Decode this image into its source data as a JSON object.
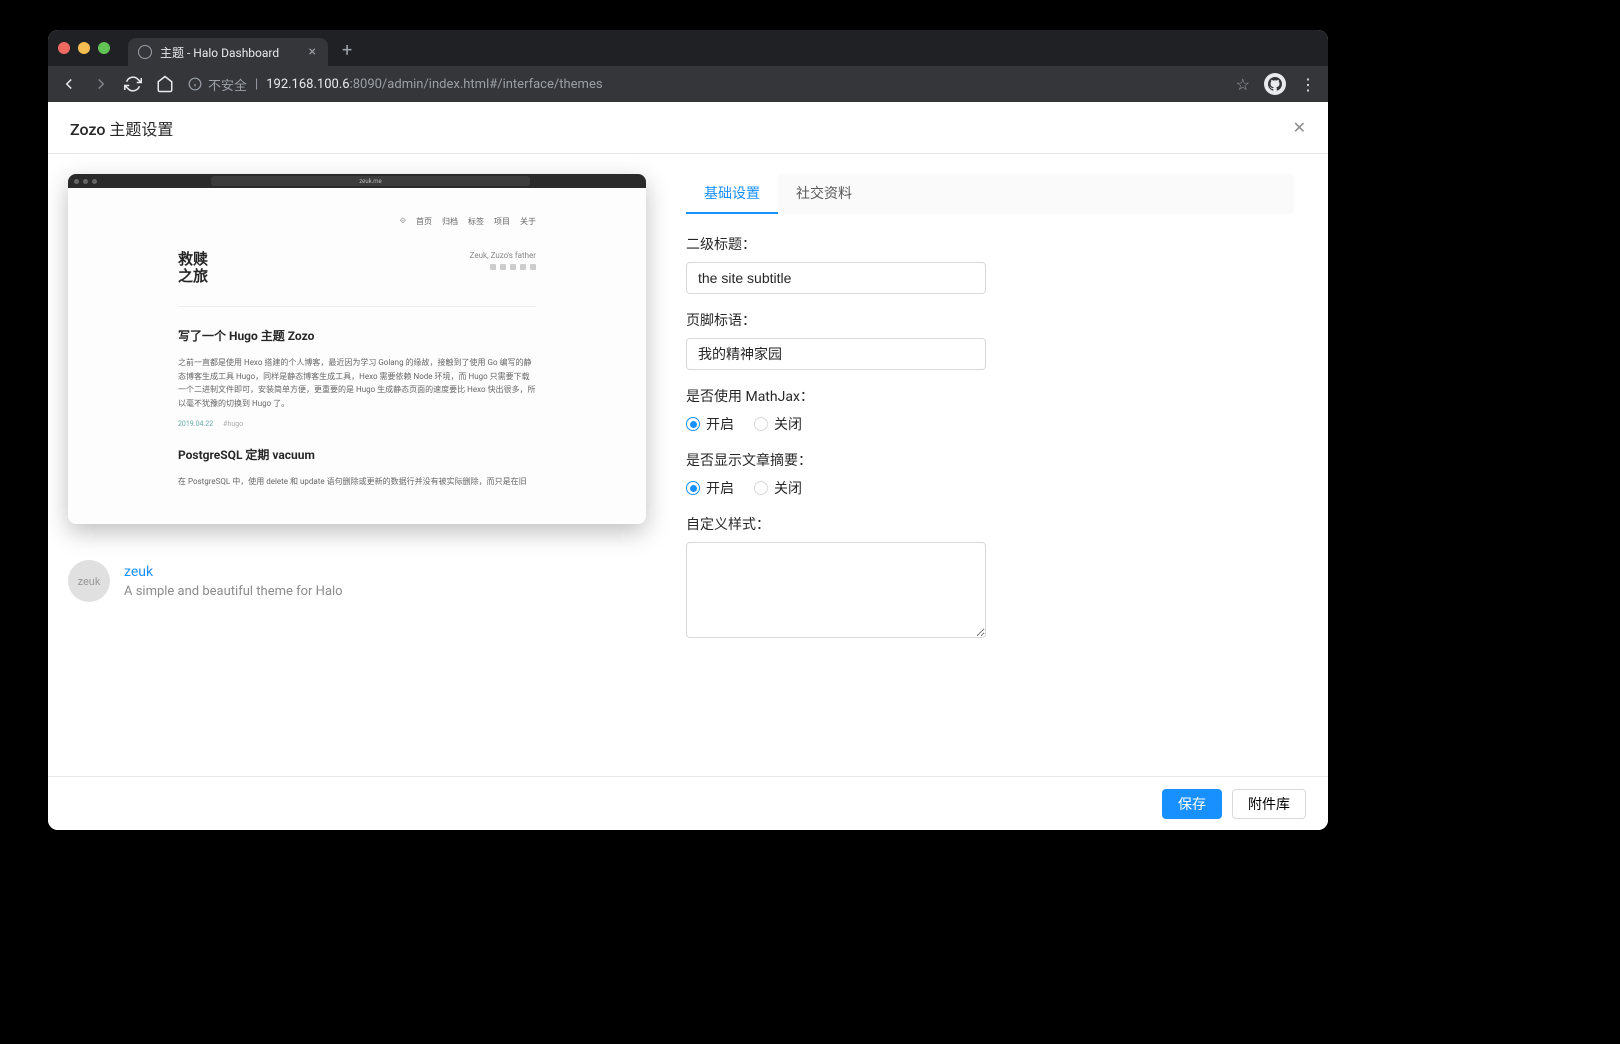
{
  "browser": {
    "tab_title": "主题 - Halo Dashboard",
    "url_security": "不安全",
    "url_host": "192.168.100.6",
    "url_path": ":8090/admin/index.html#/interface/themes"
  },
  "header": {
    "title": "Zozo 主题设置"
  },
  "preview": {
    "url": "zeuk.me",
    "nav": [
      "首页",
      "归档",
      "标签",
      "项目",
      "关于"
    ],
    "logo_line1": "救赎",
    "logo_line2": "之旅",
    "tagline": "Zeuk, Zuzo's father",
    "post1_title": "写了一个 Hugo 主题 Zozo",
    "post1_body": "之前一直都是使用 Hexo 搭建的个人博客，最近因为学习 Golang 的缘故，接触到了使用 Go 编写的静态博客生成工具 Hugo，同样是静态博客生成工具，Hexo 需要依赖 Node 环境，而 Hugo 只需要下载一个二进制文件即可，安装简单方便，更重要的是 Hugo 生成静态页面的速度要比 Hexo 快出很多，所以毫不犹豫的切换到 Hugo 了。",
    "post1_date": "2019.04.22",
    "post1_tag": "#hugo",
    "post2_title": "PostgreSQL 定期 vacuum",
    "post2_body": "在 PostgreSQL 中，使用 delete 和 update 语句删除或更新的数据行并没有被实际删除，而只是在旧"
  },
  "author": {
    "name": "zeuk",
    "avatar_text": "zeuk",
    "desc": "A simple and beautiful theme for Halo"
  },
  "tabs": {
    "basic": "基础设置",
    "social": "社交资料"
  },
  "form": {
    "subtitle_label": "二级标题：",
    "subtitle_value": "the site subtitle",
    "footer_label": "页脚标语：",
    "footer_value": "我的精神家园",
    "mathjax_label": "是否使用 MathJax：",
    "summary_label": "是否显示文章摘要：",
    "custom_css_label": "自定义样式：",
    "option_on": "开启",
    "option_off": "关闭"
  },
  "footer": {
    "save": "保存",
    "attachments": "附件库"
  }
}
